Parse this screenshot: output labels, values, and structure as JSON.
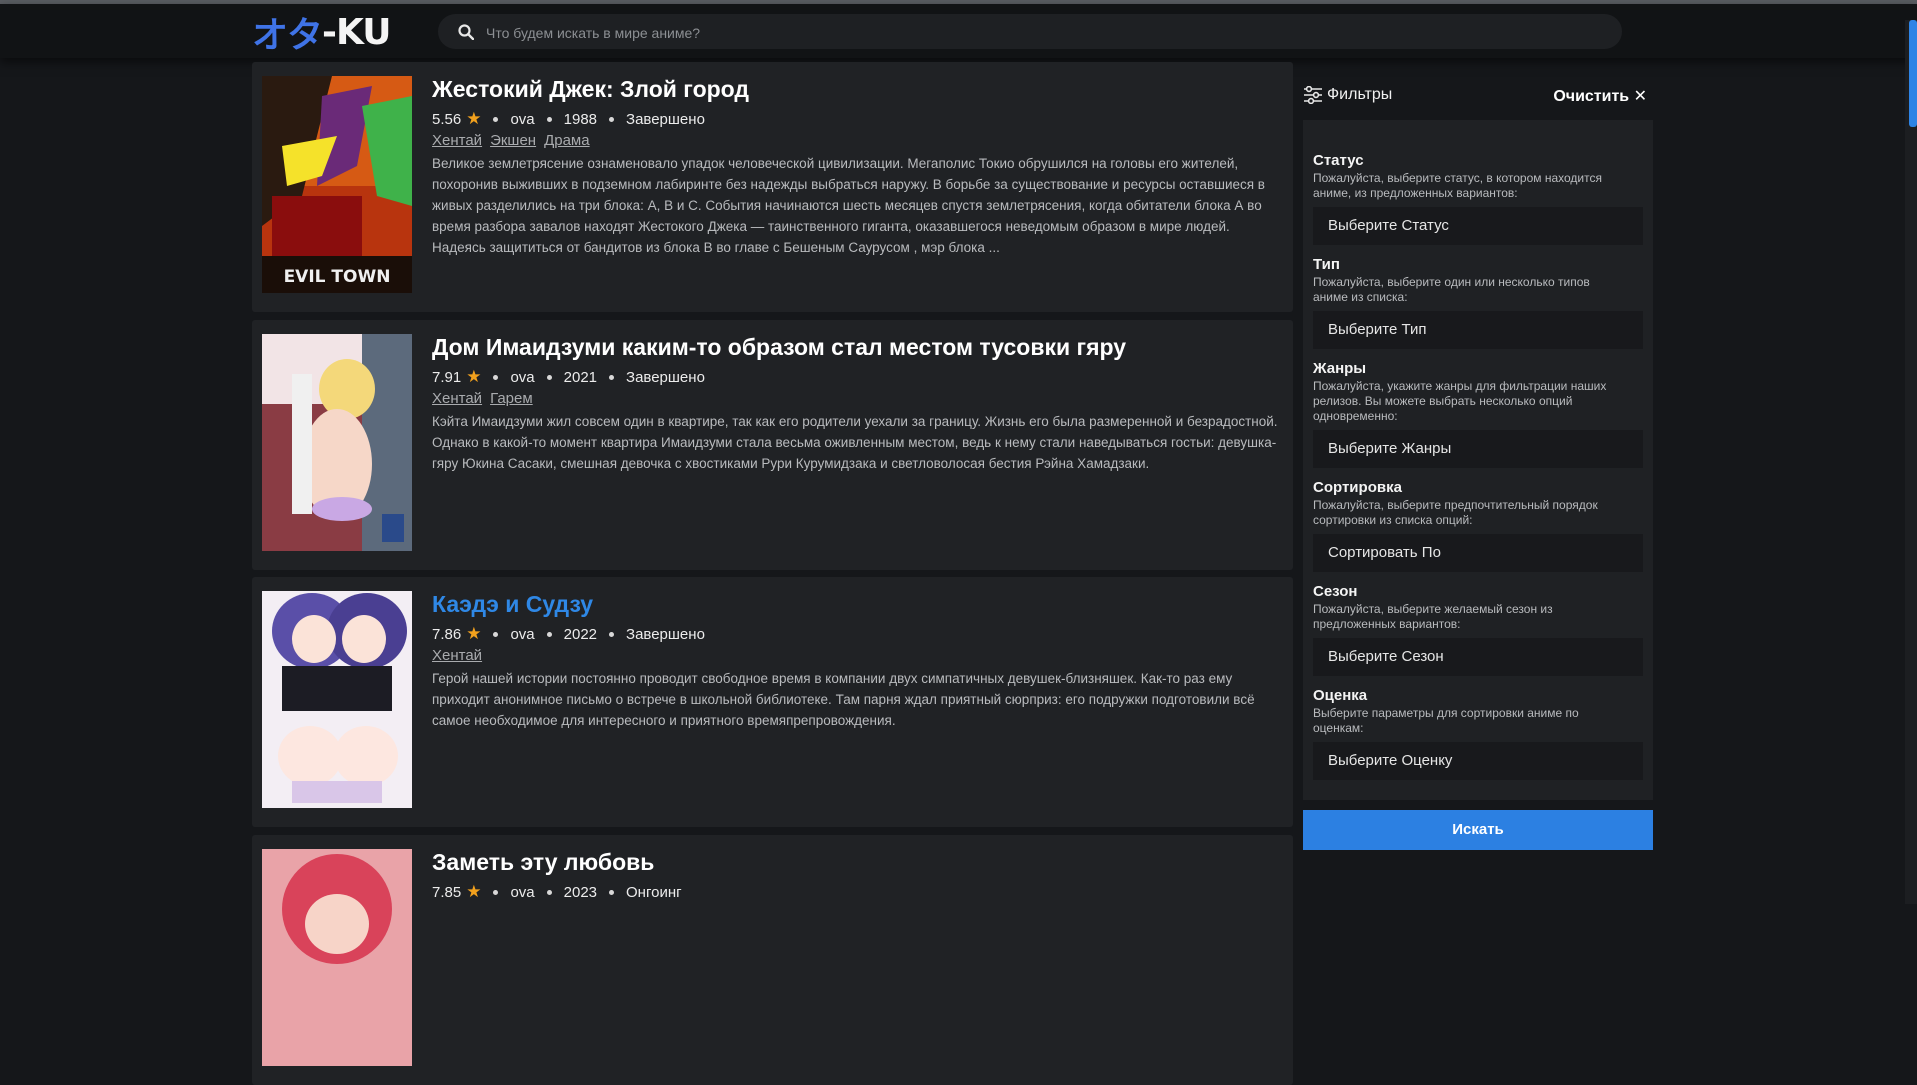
{
  "header": {
    "logo_part1": "オタ",
    "logo_part2": "-KU",
    "search_placeholder": "Что будем искать в мире аниме?"
  },
  "colors": {
    "accent": "#2c80e2",
    "star": "#f2a11d",
    "background": "#15171a",
    "card": "#202225"
  },
  "anime": [
    {
      "title": "Жестокий Джек: Злой город",
      "rating": "5.56",
      "type": "ova",
      "year": "1988",
      "status": "Завершено",
      "genres": [
        "Хентай",
        "Экшен",
        "Драма"
      ],
      "description": "Великое землетрясение ознаменовало упадок человеческой цивилизации. Мегаполис Токио обрушился на головы его жителей, похоронив выживших в подземном лабиринте без надежды выбраться наружу. В борьбе за существование и ресурсы оставшиеся в живых разделились на три блока: А, В и С. События начинаются шесть месяцев спустя землетрясения, когда обитатели блока А во время разбора завалов находят Жестокого Джека — таинственного гиганта, оказавшегося неведомым образом в мире людей. Надеясь защититься от бандитов из блока В во главе с Бешеным Саурусом , мэр блока ...",
      "poster_text": "EVIL TOWN",
      "highlighted": false
    },
    {
      "title": "Дом Имаидзуми каким-то образом стал местом тусовки гяру",
      "rating": "7.91",
      "type": "ova",
      "year": "2021",
      "status": "Завершено",
      "genres": [
        "Хентай",
        "Гарем"
      ],
      "description": "Кэйта Имаидзуми жил совсем один в квартире, так как его родители уехали за границу. Жизнь его была размеренной и безрадостной. Однако в какой-то момент квартира Имаидзуми стала весьма оживленным местом, ведь к нему стали наведываться гостьи: девушка-гяру Юкина Сасаки, смешная девочка с хвостиками Рури Курумидзака и светловолосая бестия Рэйна Хамадзаки.",
      "highlighted": false
    },
    {
      "title": "Каэдэ и Судзу",
      "rating": "7.86",
      "type": "ova",
      "year": "2022",
      "status": "Завершено",
      "genres": [
        "Хентай"
      ],
      "description": "Герой нашей истории постоянно проводит свободное время в компании двух симпатичных девушек-близняшек. Как-то раз ему приходит анонимное письмо о встрече в школьной библиотеке. Там парня ждал приятный сюрприз: его подружки подготовили всё самое необходимое для интересного и приятного времяпрепровождения.",
      "highlighted": true
    },
    {
      "title": "Заметь эту любовь",
      "rating": "7.85",
      "type": "ova",
      "year": "2023",
      "status": "Онгоинг",
      "genres": [],
      "description": "",
      "highlighted": false
    }
  ],
  "filters": {
    "title": "Фильтры",
    "clear_label": "Очистить",
    "groups": [
      {
        "title": "Статус",
        "desc": "Пожалуйста, выберите статус, в котором находится аниме, из предложенных вариантов:",
        "select": "Выберите Статус"
      },
      {
        "title": "Тип",
        "desc": "Пожалуйста, выберите один или несколько типов аниме из списка:",
        "select": "Выберите Тип"
      },
      {
        "title": "Жанры",
        "desc": "Пожалуйста, укажите жанры для фильтрации наших релизов. Вы можете выбрать несколько опций одновременно:",
        "select": "Выберите Жанры"
      },
      {
        "title": "Сортировка",
        "desc": "Пожалуйста, выберите предпочтительный порядок сортировки из списка опций:",
        "select": "Сортировать По"
      },
      {
        "title": "Сезон",
        "desc": "Пожалуйста, выберите желаемый сезон из предложенных вариантов:",
        "select": "Выберите Сезон"
      },
      {
        "title": "Оценка",
        "desc": "Выберите параметры для сортировки аниме по оценкам:",
        "select": "Выберите Оценку"
      }
    ],
    "search_button": "Искать"
  }
}
